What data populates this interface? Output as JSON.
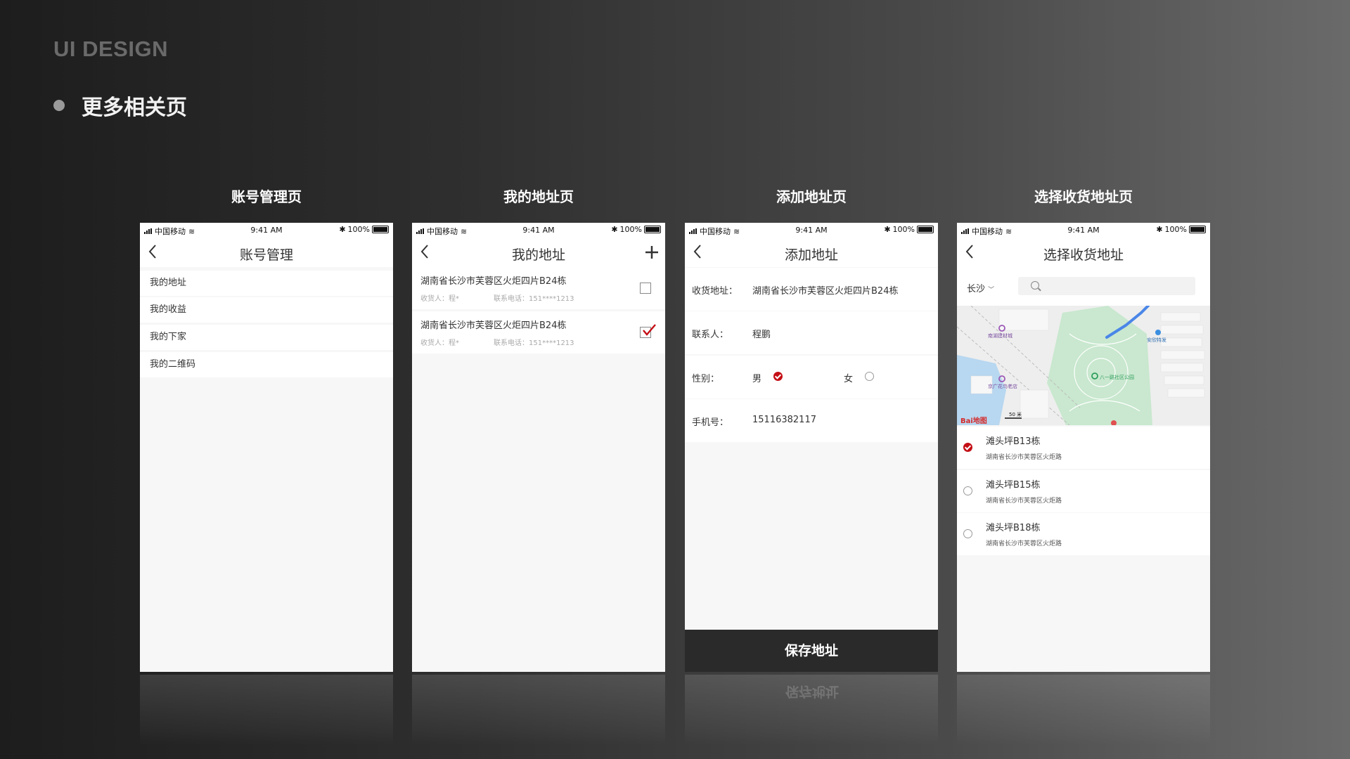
{
  "header": {
    "brand": "UI DESIGN",
    "subtitle": "更多相关页"
  },
  "status_bar": {
    "carrier": "中国移动",
    "time": "9:41 AM",
    "battery": "100%"
  },
  "phones": {
    "account": {
      "caption": "账号管理页",
      "title": "账号管理",
      "items": [
        "我的地址",
        "我的收益",
        "我的下家",
        "我的二维码"
      ]
    },
    "my_address": {
      "caption": "我的地址页",
      "title": "我的地址",
      "add_icon": "plus-icon",
      "items": [
        {
          "address": "湖南省长沙市芙蓉区火炬四片B24栋",
          "receiver": "收货人：程*",
          "phone": "联系电话：151****1213",
          "checked": false
        },
        {
          "address": "湖南省长沙市芙蓉区火炬四片B24栋",
          "receiver": "收货人：程*",
          "phone": "联系电话：151****1213",
          "checked": true
        }
      ]
    },
    "add_address": {
      "caption": "添加地址页",
      "title": "添加地址",
      "rows": [
        {
          "label": "收货地址：",
          "value": "湖南省长沙市芙蓉区火炬四片B24栋"
        },
        {
          "label": "联系人：",
          "value": "程鹏"
        },
        {
          "label": "性别：",
          "male": "男",
          "female": "女",
          "selected": "男"
        },
        {
          "label": "手机号：",
          "value": "15116382117"
        }
      ],
      "save_button": "保存地址"
    },
    "select_address": {
      "caption": "选择收货地址页",
      "title": "选择收货地址",
      "city": "长沙",
      "map": {
        "labels": [
          "南湖建材城",
          "安欣特发",
          "八一路社区公园",
          "京广花鸟老店"
        ],
        "logo": "Bai地图",
        "scale": "50 米"
      },
      "items": [
        {
          "name": "滩头坪B13栋",
          "sub": "湖南省长沙市芙蓉区火炬路",
          "selected": true
        },
        {
          "name": "滩头坪B15栋",
          "sub": "湖南省长沙市芙蓉区火炬路",
          "selected": false
        },
        {
          "name": "滩头坪B18栋",
          "sub": "湖南省长沙市芙蓉区火炬路",
          "selected": false
        }
      ]
    }
  },
  "colors": {
    "accent": "#c40f15",
    "dark_button": "#2a2a2a",
    "page_bg": "#f7f7f7"
  }
}
